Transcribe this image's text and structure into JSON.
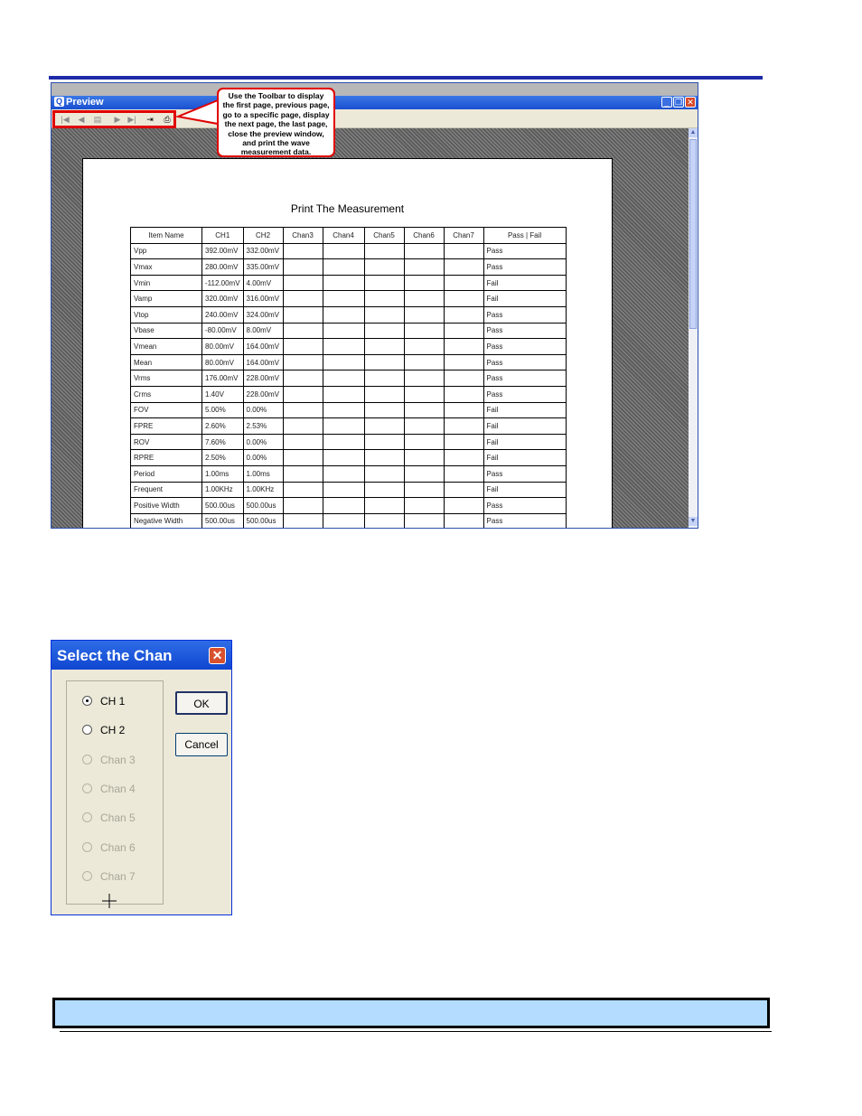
{
  "preview": {
    "title": "Preview",
    "window_buttons": {
      "minimize": "_",
      "restore": "❐",
      "close": "✕"
    },
    "toolbar": [
      {
        "name": "first-page-icon",
        "glyph": "|◀"
      },
      {
        "name": "previous-page-icon",
        "glyph": "◀"
      },
      {
        "name": "go-to-page-icon",
        "glyph": "▤"
      },
      {
        "name": "next-page-icon",
        "glyph": "▶"
      },
      {
        "name": "last-page-icon",
        "glyph": "▶|"
      },
      {
        "name": "close-preview-icon",
        "glyph": "⇥"
      },
      {
        "name": "print-icon",
        "glyph": "⎙"
      }
    ],
    "report_title": "Print The Measurement",
    "table": {
      "headers": [
        "Item Name",
        "CH1",
        "CH2",
        "Chan3",
        "Chan4",
        "Chan5",
        "Chan6",
        "Chan7",
        "Pass | Fail"
      ],
      "rows": [
        [
          "Vpp",
          "392.00mV",
          "332.00mV",
          "",
          "",
          "",
          "",
          "",
          "Pass"
        ],
        [
          "Vmax",
          "280.00mV",
          "335.00mV",
          "",
          "",
          "",
          "",
          "",
          "Pass"
        ],
        [
          "Vmin",
          "-112.00mV",
          "4.00mV",
          "",
          "",
          "",
          "",
          "",
          "Fail"
        ],
        [
          "Vamp",
          "320.00mV",
          "316.00mV",
          "",
          "",
          "",
          "",
          "",
          "Fail"
        ],
        [
          "Vtop",
          "240.00mV",
          "324.00mV",
          "",
          "",
          "",
          "",
          "",
          "Pass"
        ],
        [
          "Vbase",
          "-80.00mV",
          "8.00mV",
          "",
          "",
          "",
          "",
          "",
          "Pass"
        ],
        [
          "Vmean",
          "80.00mV",
          "164.00mV",
          "",
          "",
          "",
          "",
          "",
          "Pass"
        ],
        [
          "Mean",
          "80.00mV",
          "164.00mV",
          "",
          "",
          "",
          "",
          "",
          "Pass"
        ],
        [
          "Vrms",
          "176.00mV",
          "228.00mV",
          "",
          "",
          "",
          "",
          "",
          "Pass"
        ],
        [
          "Crms",
          "1.40V",
          "228.00mV",
          "",
          "",
          "",
          "",
          "",
          "Pass"
        ],
        [
          "FOV",
          "5.00%",
          "0.00%",
          "",
          "",
          "",
          "",
          "",
          "Fail"
        ],
        [
          "FPRE",
          "2.60%",
          "2.53%",
          "",
          "",
          "",
          "",
          "",
          "Fail"
        ],
        [
          "ROV",
          "7.60%",
          "0.00%",
          "",
          "",
          "",
          "",
          "",
          "Fail"
        ],
        [
          "RPRE",
          "2.50%",
          "0.00%",
          "",
          "",
          "",
          "",
          "",
          "Fail"
        ],
        [
          "Period",
          "1.00ms",
          "1.00ms",
          "",
          "",
          "",
          "",
          "",
          "Pass"
        ],
        [
          "Frequent",
          "1.00KHz",
          "1.00KHz",
          "",
          "",
          "",
          "",
          "",
          "Fail"
        ],
        [
          "Positive Width",
          "500.00us",
          "500.00us",
          "",
          "",
          "",
          "",
          "",
          "Pass"
        ],
        [
          "Negative Width",
          "500.00us",
          "500.00us",
          "",
          "",
          "",
          "",
          "",
          "Pass"
        ]
      ]
    }
  },
  "callout": {
    "text": "Use the Toolbar to display the first page, previous page, go to a specific page, display the next page, the last page, close the preview window, and print the wave measurement data."
  },
  "dialog": {
    "title": "Select the Chan",
    "close_glyph": "✕",
    "options": [
      {
        "label": "CH 1",
        "checked": true,
        "enabled": true
      },
      {
        "label": "CH 2",
        "checked": false,
        "enabled": true
      },
      {
        "label": "Chan 3",
        "checked": false,
        "enabled": false
      },
      {
        "label": "Chan 4",
        "checked": false,
        "enabled": false
      },
      {
        "label": "Chan 5",
        "checked": false,
        "enabled": false
      },
      {
        "label": "Chan 6",
        "checked": false,
        "enabled": false
      },
      {
        "label": "Chan 7",
        "checked": false,
        "enabled": false
      }
    ],
    "ok_label": "OK",
    "cancel_label": "Cancel"
  },
  "colors": {
    "accent_blue": "#1f2aa8",
    "highlight_red": "#e00000",
    "bottom_bar": "#b3dcff"
  }
}
